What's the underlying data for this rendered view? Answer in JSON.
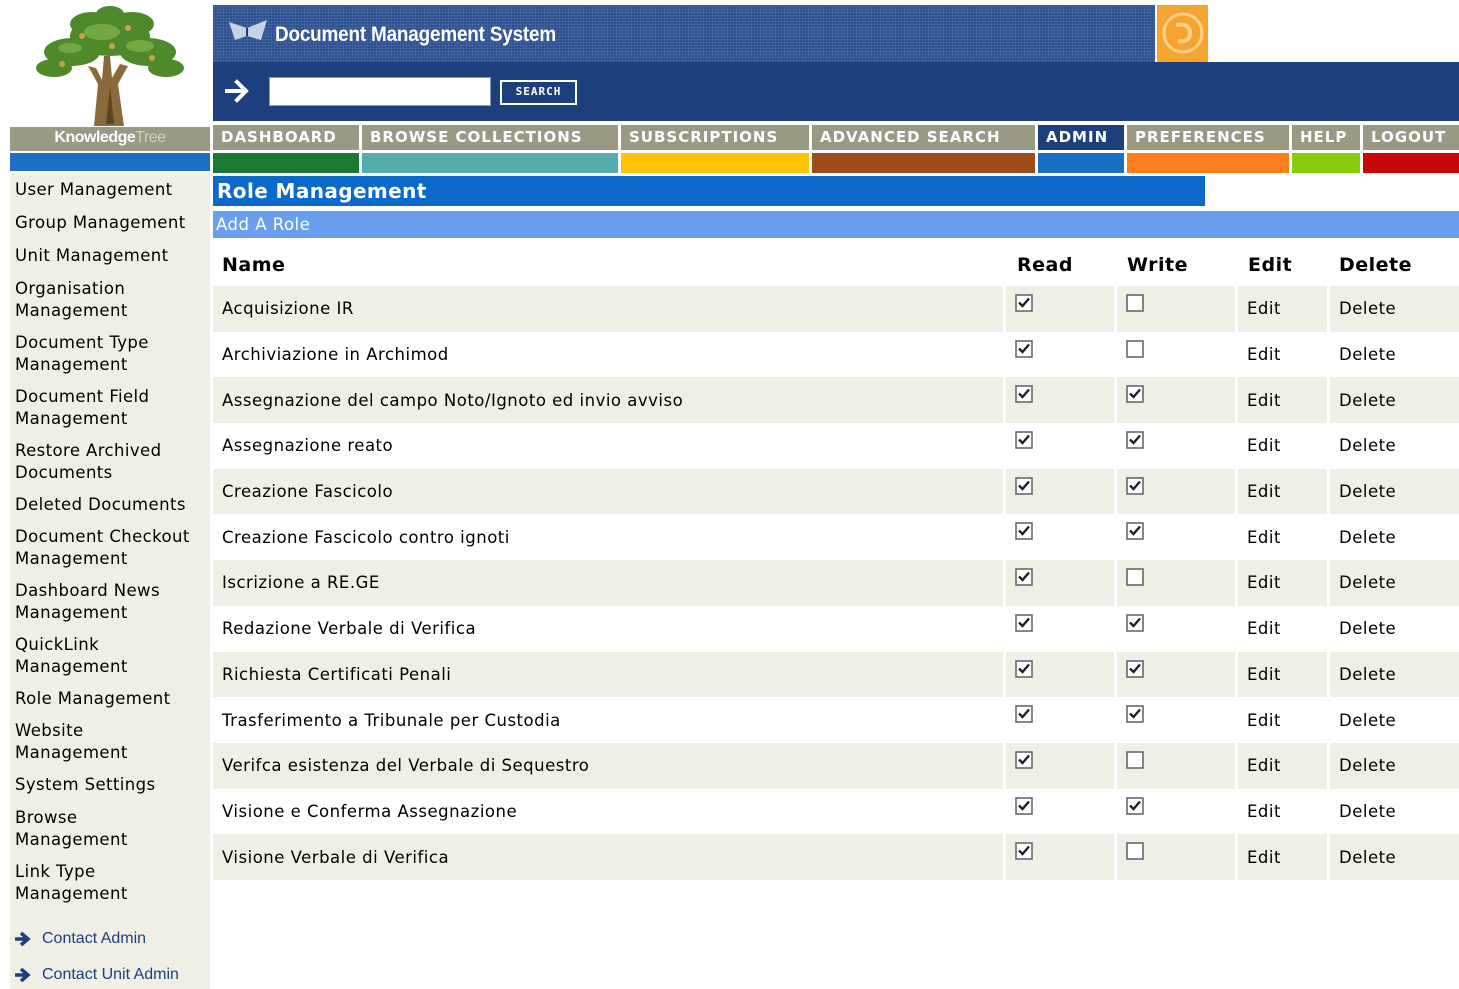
{
  "header": {
    "logo_name": "Knowledge",
    "logo_tree": "Tree",
    "app_title": "Document Management System",
    "search_placeholder": "",
    "search_value": "",
    "search_button": "SEARCH"
  },
  "nav": [
    {
      "label": "DASHBOARD",
      "color": "#1a7a32",
      "width": 146
    },
    {
      "label": "BROWSE COLLECTIONS",
      "color": "#55adab",
      "width": 256
    },
    {
      "label": "SUBSCRIPTIONS",
      "color": "#fec304",
      "width": 188
    },
    {
      "label": "ADVANCED SEARCH",
      "color": "#9d4c1a",
      "width": 223
    },
    {
      "label": "ADMIN",
      "color": "#1a6ec3",
      "width": 86,
      "active": true
    },
    {
      "label": "PREFERENCES",
      "color": "#fb7f1c",
      "width": 162
    },
    {
      "label": "HELP",
      "color": "#86cc0c",
      "width": 68
    },
    {
      "label": "LOGOUT",
      "color": "#c80707",
      "width": 96
    }
  ],
  "sidebar": {
    "links": [
      [
        "User Management"
      ],
      [
        "Group Management"
      ],
      [
        "Unit Management"
      ],
      [
        "Organisation",
        "Management"
      ],
      [
        "Document Type",
        "Management"
      ],
      [
        "Document Field",
        "Management"
      ],
      [
        "Restore Archived",
        "Documents"
      ],
      [
        "Deleted Documents"
      ],
      [
        "Document Checkout",
        "Management"
      ],
      [
        "Dashboard News",
        "Management"
      ],
      [
        "QuickLink",
        "Management"
      ],
      [
        "Role Management"
      ],
      [
        "Website",
        "Management"
      ],
      [
        "System Settings"
      ],
      [
        "Browse",
        "Management"
      ],
      [
        "Link Type",
        "Management"
      ]
    ],
    "contact_admin": "Contact Admin",
    "contact_unit_admin": "Contact Unit Admin"
  },
  "main": {
    "title": "Role Management",
    "add_role": "Add A Role",
    "columns": {
      "name": "Name",
      "read": "Read",
      "write": "Write",
      "edit": "Edit",
      "delete": "Delete"
    },
    "edit_label": "Edit",
    "delete_label": "Delete",
    "roles": [
      {
        "name": "Acquisizione IR",
        "read": true,
        "write": false
      },
      {
        "name": "Archiviazione in Archimod",
        "read": true,
        "write": false
      },
      {
        "name": "Assegnazione del campo Noto/Ignoto ed invio avviso",
        "read": true,
        "write": true
      },
      {
        "name": "Assegnazione reato",
        "read": true,
        "write": true
      },
      {
        "name": "Creazione Fascicolo",
        "read": true,
        "write": true
      },
      {
        "name": "Creazione Fascicolo contro ignoti",
        "read": true,
        "write": true
      },
      {
        "name": "Iscrizione a RE.GE",
        "read": true,
        "write": false
      },
      {
        "name": "Redazione Verbale di Verifica",
        "read": true,
        "write": true
      },
      {
        "name": "Richiesta Certificati Penali",
        "read": true,
        "write": true
      },
      {
        "name": "Trasferimento a Tribunale per Custodia",
        "read": true,
        "write": true
      },
      {
        "name": "Verifca esistenza del Verbale di Sequestro",
        "read": true,
        "write": false
      },
      {
        "name": "Visione e Conferma Assegnazione",
        "read": true,
        "write": true
      },
      {
        "name": "Visione Verbale di Verifica",
        "read": true,
        "write": false
      }
    ]
  }
}
